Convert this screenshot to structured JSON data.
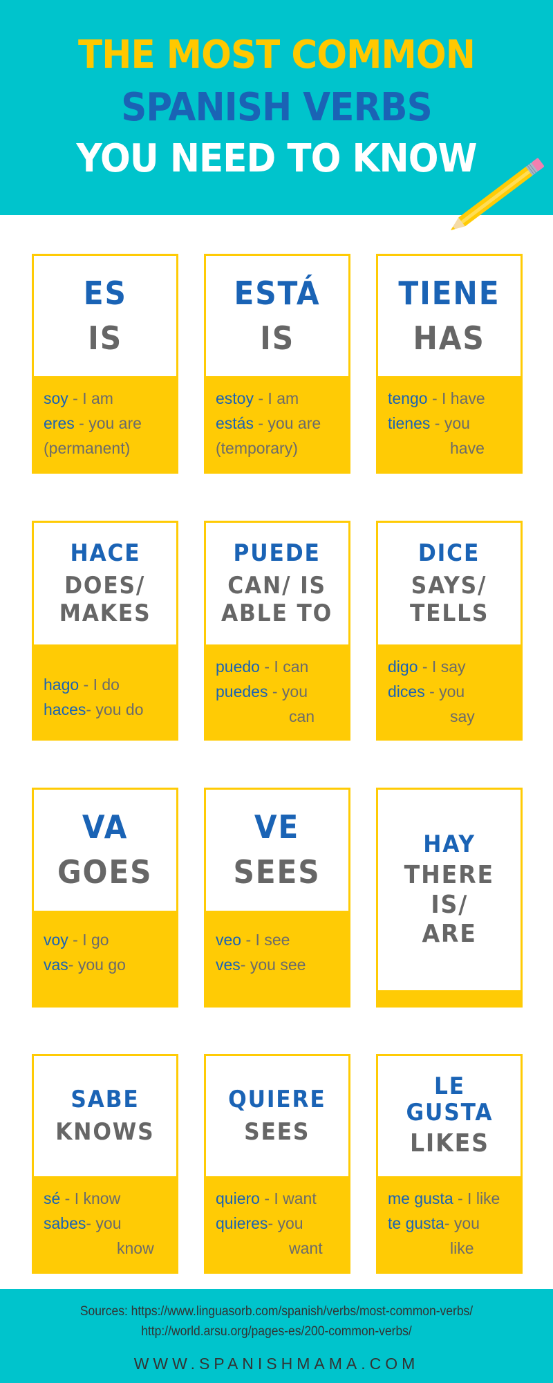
{
  "header": {
    "title_line1": "THE MOST COMMON",
    "title_line2": "SPANISH VERBS",
    "title_line3": "YOU NEED TO KNOW",
    "decoration_icon": "pencil-icon"
  },
  "colors": {
    "teal": "#00c4cc",
    "yellow": "#ffcb05",
    "blue": "#1a63b5",
    "gray": "#666666"
  },
  "cards": [
    {
      "verb": "ES",
      "meaning": [
        "IS"
      ],
      "lines": [
        {
          "es": "soy",
          "en": " - I am"
        },
        {
          "es": "eres",
          "en": " - you are"
        },
        {
          "es": "",
          "en": "(permanent)"
        }
      ]
    },
    {
      "verb": "ESTÁ",
      "meaning": [
        "IS"
      ],
      "lines": [
        {
          "es": "estoy",
          "en": " - I am"
        },
        {
          "es": "estás",
          "en": " - you are"
        },
        {
          "es": "",
          "en": "(temporary)"
        }
      ]
    },
    {
      "verb": "TIENE",
      "meaning": [
        "HAS"
      ],
      "lines": [
        {
          "es": "tengo",
          "en": " - I have"
        },
        {
          "es": "tienes",
          "en": " - you"
        },
        {
          "es": "",
          "en": "have"
        }
      ]
    },
    {
      "verb": "HACE",
      "meaning": [
        "DOES/",
        "MAKES"
      ],
      "lines": [
        {
          "es": "hago",
          "en": " - I do"
        },
        {
          "es": "haces",
          "en": "- you do"
        }
      ]
    },
    {
      "verb": "PUEDE",
      "meaning": [
        "CAN/ IS",
        "ABLE TO"
      ],
      "lines": [
        {
          "es": "puedo",
          "en": " - I can"
        },
        {
          "es": "puedes",
          "en": " - you"
        },
        {
          "es": "",
          "en": "can"
        }
      ]
    },
    {
      "verb": "DICE",
      "meaning": [
        "SAYS/",
        "TELLS"
      ],
      "lines": [
        {
          "es": "digo",
          "en": " - I say"
        },
        {
          "es": "dices",
          "en": " - you"
        },
        {
          "es": "",
          "en": "say"
        }
      ]
    },
    {
      "verb": "VA",
      "meaning": [
        "GOES"
      ],
      "lines": [
        {
          "es": "voy",
          "en": " - I go"
        },
        {
          "es": "vas",
          "en": "- you go"
        }
      ]
    },
    {
      "verb": "VE",
      "meaning": [
        "SEES"
      ],
      "lines": [
        {
          "es": "veo",
          "en": " - I see"
        },
        {
          "es": "ves",
          "en": "- you see"
        }
      ]
    },
    {
      "verb": "HAY",
      "meaning": [
        "THERE",
        "IS/",
        "ARE"
      ],
      "lines": []
    },
    {
      "verb": "SABE",
      "meaning": [
        "KNOWS"
      ],
      "lines": [
        {
          "es": "sé",
          "en": " - I know"
        },
        {
          "es": "sabes",
          "en": "- you"
        },
        {
          "es": "",
          "en": "know"
        }
      ]
    },
    {
      "verb": "QUIERE",
      "meaning": [
        "SEES"
      ],
      "lines": [
        {
          "es": "quiero",
          "en": " - I want"
        },
        {
          "es": "quieres",
          "en": "- you"
        },
        {
          "es": "",
          "en": "want"
        }
      ]
    },
    {
      "verb": "LE GUSTA",
      "verb_lines": [
        "LE",
        "GUSTA"
      ],
      "meaning": [
        "LIKES"
      ],
      "lines": [
        {
          "es": "me gusta",
          "en": " - I like"
        },
        {
          "es": "te gusta",
          "en": "- you"
        },
        {
          "es": "",
          "en": "like"
        }
      ]
    }
  ],
  "footer": {
    "sources_line1": "Sources: https://www.linguasorb.com/spanish/verbs/most-common-verbs/",
    "sources_line2": "http://world.arsu.org/pages-es/200-common-verbs/",
    "website": "WWW.SPANISHMAMA.COM"
  }
}
